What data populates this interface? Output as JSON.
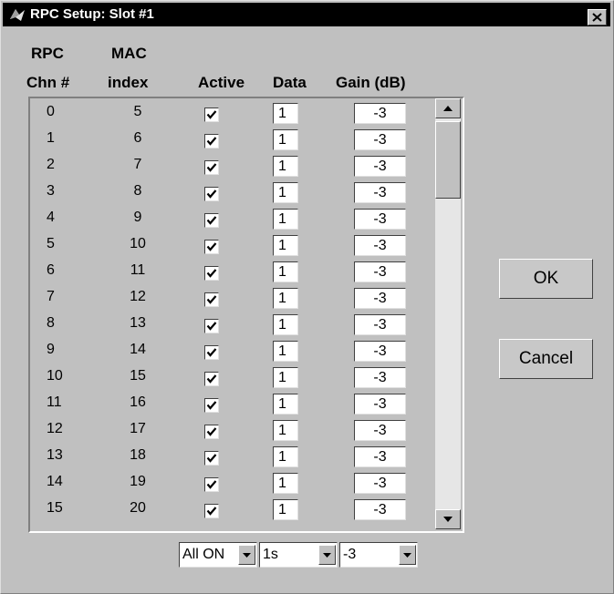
{
  "window": {
    "title": "RPC Setup: Slot #1"
  },
  "headers": {
    "rpc_line1": "RPC",
    "rpc_line2": "Chn #",
    "mac_line1": "MAC",
    "mac_line2": "index",
    "active": "Active",
    "data": "Data",
    "gain": "Gain (dB)"
  },
  "rows": [
    {
      "chn": "0",
      "mac": "5",
      "active": true,
      "data": "1",
      "gain": "-3"
    },
    {
      "chn": "1",
      "mac": "6",
      "active": true,
      "data": "1",
      "gain": "-3"
    },
    {
      "chn": "2",
      "mac": "7",
      "active": true,
      "data": "1",
      "gain": "-3"
    },
    {
      "chn": "3",
      "mac": "8",
      "active": true,
      "data": "1",
      "gain": "-3"
    },
    {
      "chn": "4",
      "mac": "9",
      "active": true,
      "data": "1",
      "gain": "-3"
    },
    {
      "chn": "5",
      "mac": "10",
      "active": true,
      "data": "1",
      "gain": "-3"
    },
    {
      "chn": "6",
      "mac": "11",
      "active": true,
      "data": "1",
      "gain": "-3"
    },
    {
      "chn": "7",
      "mac": "12",
      "active": true,
      "data": "1",
      "gain": "-3"
    },
    {
      "chn": "8",
      "mac": "13",
      "active": true,
      "data": "1",
      "gain": "-3"
    },
    {
      "chn": "9",
      "mac": "14",
      "active": true,
      "data": "1",
      "gain": "-3"
    },
    {
      "chn": "10",
      "mac": "15",
      "active": true,
      "data": "1",
      "gain": "-3"
    },
    {
      "chn": "11",
      "mac": "16",
      "active": true,
      "data": "1",
      "gain": "-3"
    },
    {
      "chn": "12",
      "mac": "17",
      "active": true,
      "data": "1",
      "gain": "-3"
    },
    {
      "chn": "13",
      "mac": "18",
      "active": true,
      "data": "1",
      "gain": "-3"
    },
    {
      "chn": "14",
      "mac": "19",
      "active": true,
      "data": "1",
      "gain": "-3"
    },
    {
      "chn": "15",
      "mac": "20",
      "active": true,
      "data": "1",
      "gain": "-3"
    }
  ],
  "buttons": {
    "ok": "OK",
    "cancel": "Cancel"
  },
  "popups": {
    "active_all": "All ON",
    "data_all": "1s",
    "gain_all": "-3"
  },
  "icons": {
    "title": "matlab-icon",
    "close": "close-icon",
    "scroll_up": "scroll-up-arrow-icon",
    "scroll_down": "scroll-down-arrow-icon",
    "checkbox": "checkmark-icon",
    "dropdown": "dropdown-arrow-icon"
  }
}
